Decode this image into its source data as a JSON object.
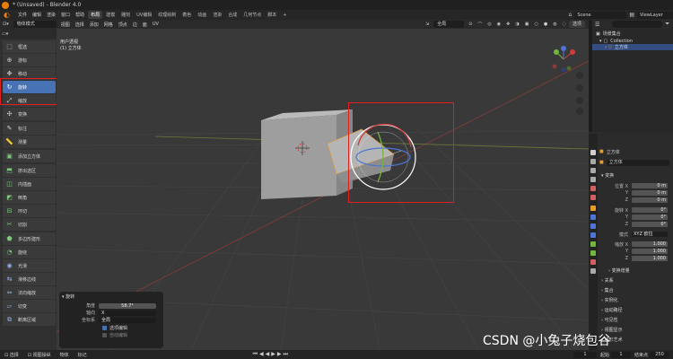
{
  "window": {
    "title": "* (Unsaved) - Blender 4.0"
  },
  "menubar": {
    "menus": [
      "文件",
      "编辑",
      "渲染",
      "窗口",
      "帮助"
    ],
    "workspaces": [
      "布局",
      "建模",
      "雕刻",
      "UV编辑",
      "纹理绘制",
      "着色",
      "动画",
      "渲染",
      "合成",
      "几何节点",
      "脚本"
    ],
    "scene": "Scene",
    "view_layer": "ViewLayer"
  },
  "viewport_header": {
    "mode": "物体模式",
    "menus": [
      "视图",
      "选择",
      "添加",
      "网格",
      "顶点",
      "边",
      "面",
      "UV"
    ],
    "orientation": "全局",
    "select_button": "选项"
  },
  "toolbar": {
    "tools": [
      {
        "label": "框选",
        "icon": "select-box-icon"
      },
      {
        "label": "游标",
        "icon": "cursor-icon"
      },
      {
        "label": "移动",
        "icon": "move-icon"
      },
      {
        "label": "旋转",
        "icon": "rotate-icon"
      },
      {
        "label": "缩放",
        "icon": "scale-icon"
      },
      {
        "label": "变换",
        "icon": "transform-icon"
      },
      {
        "label": "标注",
        "icon": "annotate-icon"
      },
      {
        "label": "测量",
        "icon": "measure-icon"
      },
      {
        "label": "添加立方体",
        "icon": "add-cube-icon"
      },
      {
        "label": "挤出选区",
        "icon": "extrude-icon"
      },
      {
        "label": "内插面",
        "icon": "inset-icon"
      },
      {
        "label": "倒角",
        "icon": "bevel-icon"
      },
      {
        "label": "环切",
        "icon": "loop-cut-icon"
      },
      {
        "label": "切割",
        "icon": "knife-icon"
      },
      {
        "label": "多边形建形",
        "icon": "poly-build-icon"
      },
      {
        "label": "旋绕",
        "icon": "spin-icon"
      },
      {
        "label": "光滑",
        "icon": "smooth-icon"
      },
      {
        "label": "滑移边线",
        "icon": "edge-slide-icon"
      },
      {
        "label": "法向缩放",
        "icon": "shrink-fatten-icon"
      },
      {
        "label": "切变",
        "icon": "shear-icon"
      },
      {
        "label": "断离区域",
        "icon": "rip-region-icon"
      }
    ],
    "active_tool": "旋转"
  },
  "viewport": {
    "view_name": "用户透视",
    "object_info": "(1) 立方体"
  },
  "operator_panel": {
    "title": "旋转",
    "angle_label": "角度",
    "angle_value": "58.7°",
    "axis_label": "轴向",
    "axis_value": "X",
    "orientation_label": "坐标系",
    "orientation_value": "全局",
    "option1": "选项编辑",
    "option2": "自动编辑"
  },
  "outliner": {
    "scene_collection": "场景集合",
    "collection": "Collection",
    "object": "立方体"
  },
  "properties": {
    "object_name": "立方体",
    "object_field": "立方体",
    "transform_header": "变换",
    "rows": [
      {
        "label": "位置 X",
        "value": "0 m"
      },
      {
        "label": "Y",
        "value": "0 m"
      },
      {
        "label": "Z",
        "value": "0 m"
      },
      {
        "label": "旋转 X",
        "value": "0°"
      },
      {
        "label": "Y",
        "value": "0°"
      },
      {
        "label": "Z",
        "value": "0°"
      },
      {
        "label": "模式",
        "value": "XYZ 欧拉"
      },
      {
        "label": "缩放 X",
        "value": "1.000"
      },
      {
        "label": "Y",
        "value": "1.000"
      },
      {
        "label": "Z",
        "value": "1.000"
      }
    ],
    "delta_transform": "变换增量",
    "sections": [
      "关系",
      "集合",
      "实例化",
      "运动路径",
      "可见性",
      "视图显示",
      "线形艺术"
    ]
  },
  "statusbar": {
    "items": [
      "选择",
      "视图操纵",
      "物体",
      "标记"
    ],
    "frame_start": "1",
    "frame_current": "1",
    "start_label": "起始",
    "end_label": "结束点",
    "frame_end": "250"
  },
  "watermark": "CSDN @小兔子烧包谷"
}
